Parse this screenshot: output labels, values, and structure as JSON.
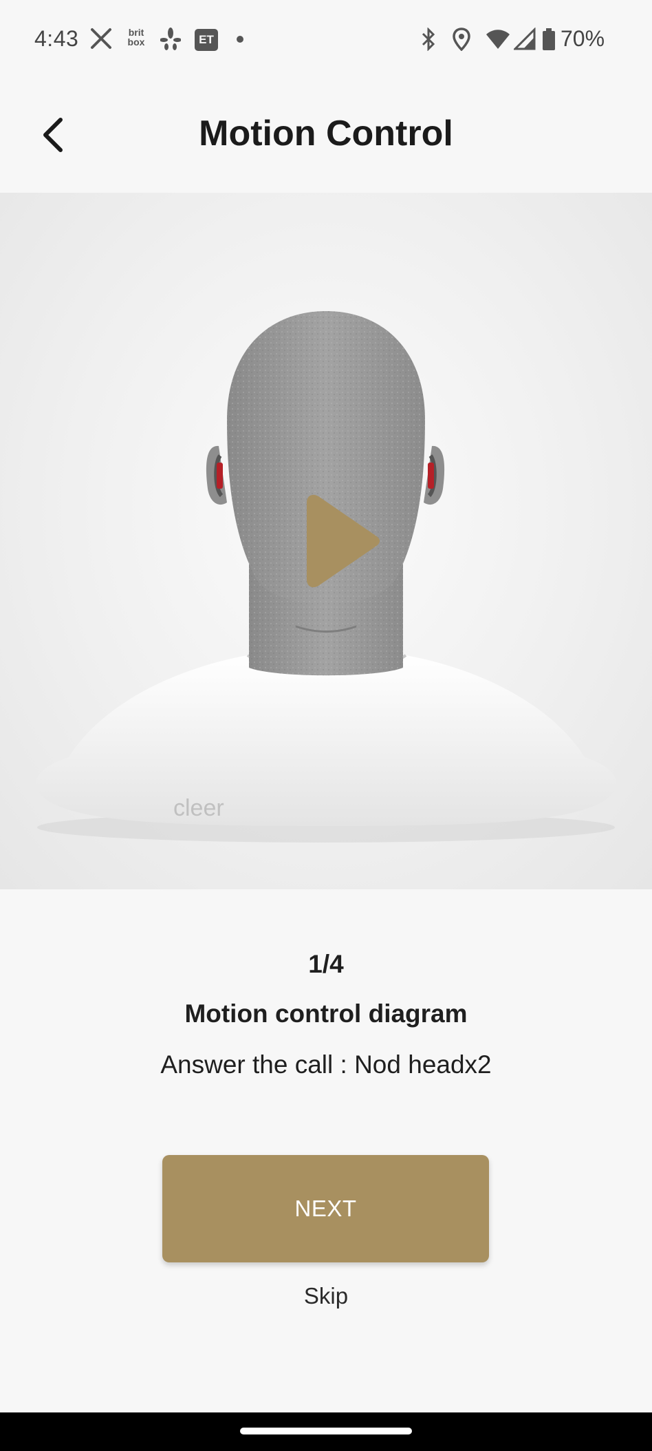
{
  "status_bar": {
    "time": "4:43",
    "britbox_label": "brit box",
    "et_label": "ET",
    "battery_percent": "70%",
    "icons": [
      "x-icon",
      "britbox-icon",
      "yelp-icon",
      "et-icon",
      "notification-dot-icon",
      "bluetooth-icon",
      "location-icon",
      "wifi-icon",
      "signal-icon",
      "battery-icon"
    ]
  },
  "header": {
    "title": "Motion Control",
    "back_icon": "chevron-left-icon"
  },
  "media": {
    "brand_text": "cleer",
    "play_icon": "play-icon",
    "play_color": "#a89060"
  },
  "content": {
    "step_counter": "1/4",
    "diagram_title": "Motion control diagram",
    "instruction": "Answer the call : Nod headx2"
  },
  "actions": {
    "next_label": "NEXT",
    "skip_label": "Skip",
    "accent_color": "#a89060"
  }
}
